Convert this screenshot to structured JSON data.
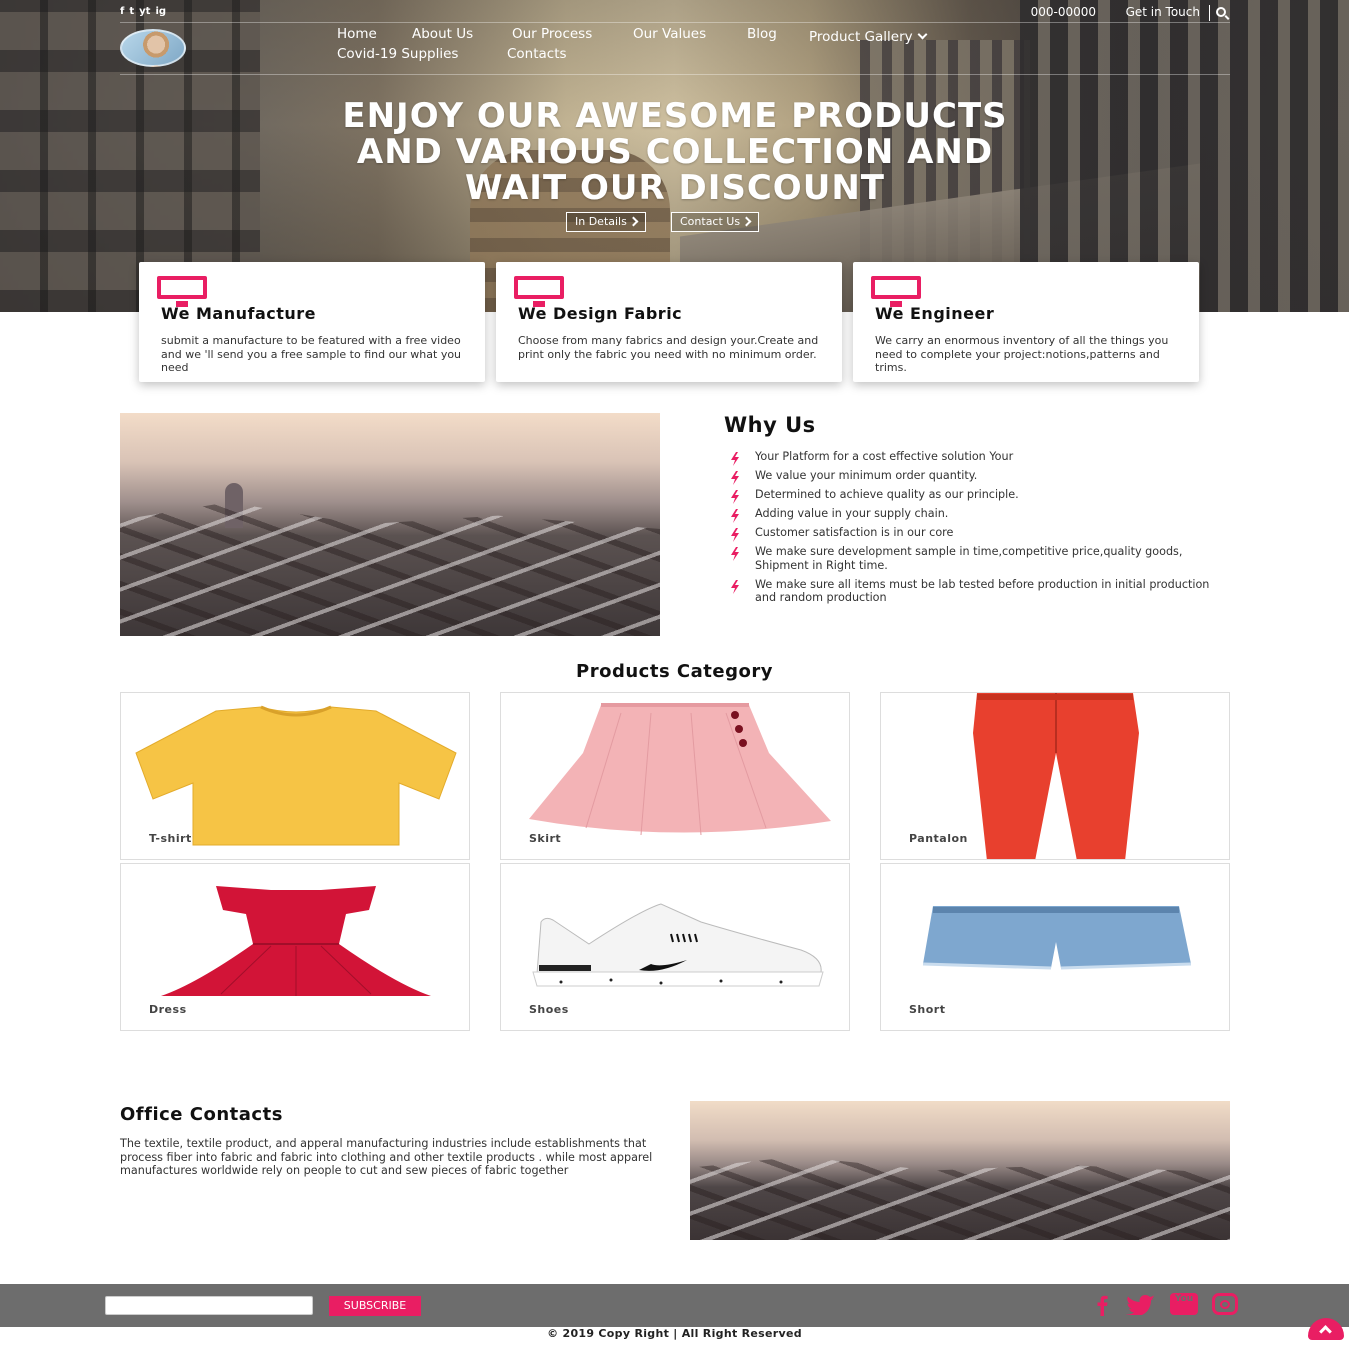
{
  "topbar": {
    "social": [
      "f",
      "t",
      "yt",
      "ig"
    ],
    "phone": "000-00000",
    "get_in_touch": "Get in Touch"
  },
  "nav": {
    "items": [
      "Home",
      "About Us",
      "Our Process",
      "Our Values",
      "Blog",
      "Product Gallery",
      "Covid-19 Supplies",
      "Contacts"
    ]
  },
  "hero": {
    "title_lines": [
      "ENJOY OUR AWESOME PRODUCTS",
      "AND VARIOUS COLLECTION AND",
      "WAIT OUR DISCOUNT"
    ],
    "btn_details": "In Details",
    "btn_contact": "Contact Us"
  },
  "services": [
    {
      "title": "We Manufacture",
      "text": "submit a manufacture to be featured with a free video and we 'll send you a free sample to find our what you need"
    },
    {
      "title": "We Design Fabric",
      "text": "Choose from many fabrics and design your.Create and print only the fabric you need with no minimum order."
    },
    {
      "title": "We Engineer",
      "text": "We carry an enormous inventory of all the things you need to complete your project:notions,patterns and trims."
    }
  ],
  "why": {
    "title": "Why Us",
    "items": [
      "Your Platform for a cost effective solution Your",
      "We value your minimum order quantity.",
      "Determined to achieve quality as our principle.",
      "Adding value in your supply chain.",
      "Customer satisfaction is in our core",
      "We make sure development sample in time,competitive price,quality goods, Shipment in Right time.",
      "We make sure all items must be lab tested before production in initial production and random production"
    ]
  },
  "products": {
    "title": "Products Category",
    "items": [
      "T-shirt",
      "Skirt",
      "Pantalon",
      "Dress",
      "Shoes",
      "Short"
    ]
  },
  "office": {
    "title": "Office Contacts",
    "text": "The textile, textile product, and apperal manufacturing industries include establishments that process fiber into fabric and fabric into clothing and other textile products . while most apparel manufactures worldwide rely on people to cut and sew pieces of fabric together"
  },
  "footer": {
    "subscribe": "SUBSCRIBE",
    "email_placeholder": "",
    "copyright": "© 2019 Copy Right | All Right Reserved",
    "social_youtube": "You"
  },
  "colors": {
    "accent": "#e91e63",
    "footer": "#6d6d6d"
  }
}
